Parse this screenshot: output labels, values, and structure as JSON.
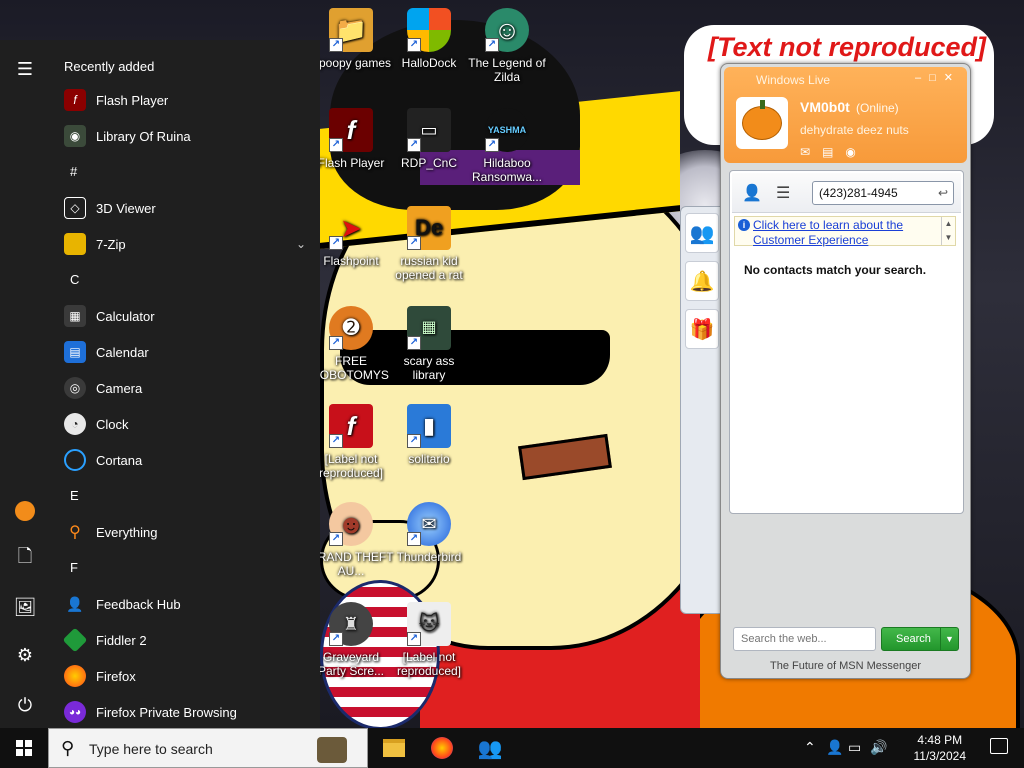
{
  "wallpaper": {
    "caption": "[Text not reproduced]"
  },
  "desktop": {
    "icons": [
      {
        "label": "Spoopy games",
        "icon": "folder-icon"
      },
      {
        "label": "HalloDock",
        "icon": "shield-icon"
      },
      {
        "label": "The Legend of Zilda",
        "icon": "game-character-icon"
      },
      {
        "label": "Flash Player",
        "icon": "flash-icon"
      },
      {
        "label": "RDP_CnC",
        "icon": "remote-desktop-icon"
      },
      {
        "label": "Hildaboo Ransomwa...",
        "icon": "yashma-icon"
      },
      {
        "label": "Flashpoint",
        "icon": "flashpoint-icon"
      },
      {
        "label": "russian kid opened a rat",
        "icon": "de-icon"
      },
      {
        "label": "FREE LOBOTOMYS",
        "icon": "compass-icon"
      },
      {
        "label": "scary ass library",
        "icon": "library-icon"
      },
      {
        "label": "[Label not reproduced]",
        "icon": "flash-icon"
      },
      {
        "label": "solitario",
        "icon": "cards-icon"
      },
      {
        "label": "GRAND THEFT AU...",
        "icon": "anime-character-icon"
      },
      {
        "label": "Thunderbird",
        "icon": "thunderbird-icon"
      },
      {
        "label": "Graveyard Party Scre...",
        "icon": "vote-badge-icon"
      },
      {
        "label": "[Label not reproduced]",
        "icon": "pixel-cat-icon"
      }
    ]
  },
  "start_menu": {
    "recently_added_heading": "Recently added",
    "recent": [
      {
        "label": "Flash Player",
        "icon": "flash-icon",
        "color": "#8b0000"
      },
      {
        "label": "Library Of Ruina",
        "icon": "ruina-icon",
        "color": "#3b4a3a"
      }
    ],
    "groups": [
      {
        "letter": "#",
        "apps": [
          {
            "label": "3D Viewer",
            "icon": "cube-icon",
            "color": "#1f1f1f"
          },
          {
            "label": "7-Zip",
            "icon": "folder-icon",
            "color": "#e8b400",
            "expandable": true
          }
        ]
      },
      {
        "letter": "C",
        "apps": [
          {
            "label": "Calculator",
            "icon": "calculator-icon",
            "color": "#3a3a3a"
          },
          {
            "label": "Calendar",
            "icon": "calendar-icon",
            "color": "#1e6fd8"
          },
          {
            "label": "Camera",
            "icon": "camera-icon",
            "color": "#3a3a3a"
          },
          {
            "label": "Clock",
            "icon": "clock-icon",
            "color": "#555555"
          },
          {
            "label": "Cortana",
            "icon": "cortana-icon",
            "color": "#1f1f1f"
          }
        ]
      },
      {
        "letter": "E",
        "apps": [
          {
            "label": "Everything",
            "icon": "magnifier-icon",
            "color": "#1f1f1f"
          }
        ]
      },
      {
        "letter": "F",
        "apps": [
          {
            "label": "Feedback Hub",
            "icon": "feedback-icon",
            "color": "#1f1f1f"
          },
          {
            "label": "Fiddler 2",
            "icon": "fiddler-icon",
            "color": "#1f9a3a"
          },
          {
            "label": "Firefox",
            "icon": "firefox-icon",
            "color": "#ff6a1a"
          },
          {
            "label": "Firefox Private Browsing",
            "icon": "firefox-private-icon",
            "color": "#7a2ad8"
          }
        ]
      }
    ],
    "rail": [
      "hamburger-icon",
      "user-avatar-icon",
      "documents-icon",
      "pictures-icon",
      "settings-icon",
      "power-icon"
    ]
  },
  "msn": {
    "title": "Windows Live",
    "display_name": "VM0b0t",
    "status": "(Online)",
    "personal_message": "dehydrate deez nuts",
    "search_value": "(423)281-4945",
    "promo_text": "Click here to learn about the Customer Experience",
    "empty_message": "No contacts match your search.",
    "web_search_placeholder": "Search the web...",
    "search_button": "Search",
    "footer": "The Future of MSN Messenger"
  },
  "taskbar": {
    "search_placeholder": "Type here to search",
    "apps": [
      "file-explorer-icon",
      "firefox-icon",
      "msn-messenger-icon"
    ],
    "time": "4:48 PM",
    "date": "11/3/2024"
  },
  "colors": {
    "msn_accent": "#f79a3a",
    "search_green": "#22962c",
    "start_bg": "#1f1f1f",
    "taskbar_bg": "#101010"
  }
}
